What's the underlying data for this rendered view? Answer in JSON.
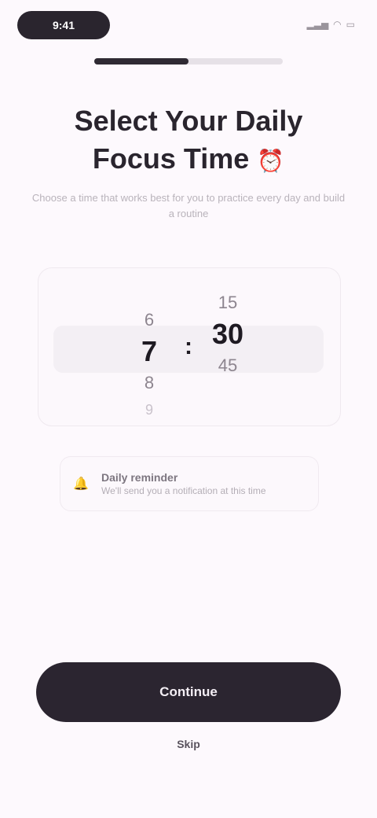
{
  "status_bar": {
    "time": "9:41",
    "signal_icon": "signal-icon",
    "wifi_icon": "wifi-icon",
    "battery_icon": "battery-icon"
  },
  "progress": {
    "value": 0.5
  },
  "header": {
    "title_line1": "Select Your Daily",
    "title_line2": "Focus Time",
    "title_emoji": "⏰",
    "subtitle": "Choose a time that works best for you to practice every day and build a routine"
  },
  "time_picker": {
    "hours": [
      "6",
      "7",
      "8",
      "9"
    ],
    "selected_hour_index": 1,
    "separator": ":",
    "minutes": [
      "15",
      "30",
      "45"
    ],
    "selected_minute_index": 1
  },
  "reminder": {
    "icon": "bell-icon",
    "title": "Daily reminder",
    "subtitle": "We'll send you a notification at this time"
  },
  "actions": {
    "continue_label": "Continue",
    "skip_label": "Skip"
  }
}
